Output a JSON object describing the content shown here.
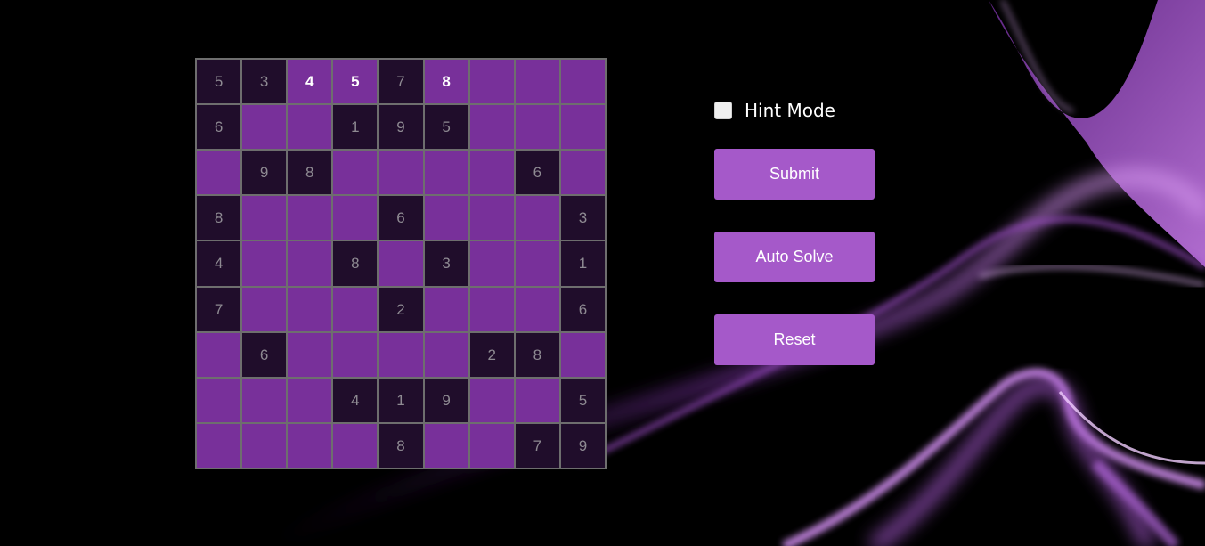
{
  "theme": {
    "background": "#000000",
    "given_cell": "#200d2b",
    "open_cell": "#78309a",
    "button": "#a559c9",
    "given_text": "#8e8a92",
    "user_text": "#ffffff"
  },
  "board": {
    "rows": [
      [
        {
          "v": "5",
          "t": "given"
        },
        {
          "v": "3",
          "t": "given"
        },
        {
          "v": "4",
          "t": "user"
        },
        {
          "v": "5",
          "t": "user"
        },
        {
          "v": "7",
          "t": "given"
        },
        {
          "v": "8",
          "t": "user"
        },
        {
          "v": "",
          "t": "empty"
        },
        {
          "v": "",
          "t": "empty"
        },
        {
          "v": "",
          "t": "empty"
        }
      ],
      [
        {
          "v": "6",
          "t": "given"
        },
        {
          "v": "",
          "t": "empty"
        },
        {
          "v": "",
          "t": "empty"
        },
        {
          "v": "1",
          "t": "given"
        },
        {
          "v": "9",
          "t": "given"
        },
        {
          "v": "5",
          "t": "given"
        },
        {
          "v": "",
          "t": "empty"
        },
        {
          "v": "",
          "t": "empty"
        },
        {
          "v": "",
          "t": "empty"
        }
      ],
      [
        {
          "v": "",
          "t": "empty"
        },
        {
          "v": "9",
          "t": "given"
        },
        {
          "v": "8",
          "t": "given"
        },
        {
          "v": "",
          "t": "empty"
        },
        {
          "v": "",
          "t": "empty"
        },
        {
          "v": "",
          "t": "empty"
        },
        {
          "v": "",
          "t": "empty"
        },
        {
          "v": "6",
          "t": "given"
        },
        {
          "v": "",
          "t": "empty"
        }
      ],
      [
        {
          "v": "8",
          "t": "given"
        },
        {
          "v": "",
          "t": "empty"
        },
        {
          "v": "",
          "t": "empty"
        },
        {
          "v": "",
          "t": "empty"
        },
        {
          "v": "6",
          "t": "given"
        },
        {
          "v": "",
          "t": "empty"
        },
        {
          "v": "",
          "t": "empty"
        },
        {
          "v": "",
          "t": "empty"
        },
        {
          "v": "3",
          "t": "given"
        }
      ],
      [
        {
          "v": "4",
          "t": "given"
        },
        {
          "v": "",
          "t": "empty"
        },
        {
          "v": "",
          "t": "empty"
        },
        {
          "v": "8",
          "t": "given"
        },
        {
          "v": "",
          "t": "empty"
        },
        {
          "v": "3",
          "t": "given"
        },
        {
          "v": "",
          "t": "empty"
        },
        {
          "v": "",
          "t": "empty"
        },
        {
          "v": "1",
          "t": "given"
        }
      ],
      [
        {
          "v": "7",
          "t": "given"
        },
        {
          "v": "",
          "t": "empty"
        },
        {
          "v": "",
          "t": "empty"
        },
        {
          "v": "",
          "t": "empty"
        },
        {
          "v": "2",
          "t": "given"
        },
        {
          "v": "",
          "t": "empty"
        },
        {
          "v": "",
          "t": "empty"
        },
        {
          "v": "",
          "t": "empty"
        },
        {
          "v": "6",
          "t": "given"
        }
      ],
      [
        {
          "v": "",
          "t": "empty"
        },
        {
          "v": "6",
          "t": "given"
        },
        {
          "v": "",
          "t": "empty"
        },
        {
          "v": "",
          "t": "empty"
        },
        {
          "v": "",
          "t": "empty"
        },
        {
          "v": "",
          "t": "empty"
        },
        {
          "v": "2",
          "t": "given"
        },
        {
          "v": "8",
          "t": "given"
        },
        {
          "v": "",
          "t": "empty"
        }
      ],
      [
        {
          "v": "",
          "t": "empty"
        },
        {
          "v": "",
          "t": "empty"
        },
        {
          "v": "",
          "t": "empty"
        },
        {
          "v": "4",
          "t": "given"
        },
        {
          "v": "1",
          "t": "given"
        },
        {
          "v": "9",
          "t": "given"
        },
        {
          "v": "",
          "t": "empty"
        },
        {
          "v": "",
          "t": "empty"
        },
        {
          "v": "5",
          "t": "given"
        }
      ],
      [
        {
          "v": "",
          "t": "empty"
        },
        {
          "v": "",
          "t": "empty"
        },
        {
          "v": "",
          "t": "empty"
        },
        {
          "v": "",
          "t": "empty"
        },
        {
          "v": "8",
          "t": "given"
        },
        {
          "v": "",
          "t": "empty"
        },
        {
          "v": "",
          "t": "empty"
        },
        {
          "v": "7",
          "t": "given"
        },
        {
          "v": "9",
          "t": "given"
        }
      ]
    ]
  },
  "controls": {
    "hint_label": "Hint Mode",
    "hint_checked": false,
    "submit_label": "Submit",
    "auto_solve_label": "Auto Solve",
    "reset_label": "Reset"
  }
}
